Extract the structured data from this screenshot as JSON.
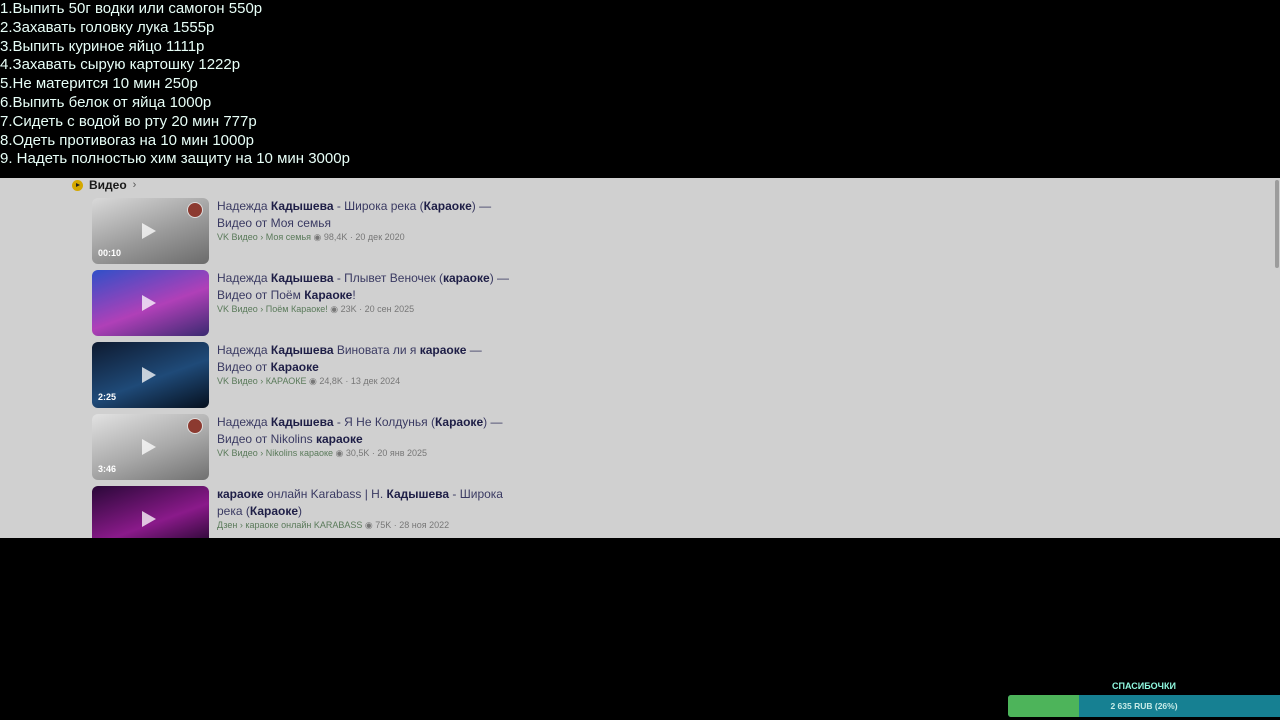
{
  "overlay": {
    "lines": [
      "1.Выпить 50г водки или самогон 550р",
      "2.Захавать головку лука 1555р",
      "3.Выпить куриное яйцо 1111р",
      "4.Захавать сырую картошку 1222р",
      "5.Не матерится 10 мин 250р",
      "6.Выпить белок от яйца 1000р",
      "7.Сидеть с водой во рту 20 мин 777р",
      "8.Одеть противогаз на 10 мин 1000р",
      "9. Надеть полностью хим защиту на 10 мин 3000р"
    ]
  },
  "video_section": {
    "title": "Видео",
    "chevron": "›",
    "items": [
      {
        "title_parts": [
          [
            "Надежда ",
            false
          ],
          [
            "Кадышева",
            true
          ],
          [
            " - Широка река (",
            false
          ],
          [
            "Караоке",
            true
          ],
          [
            ") — Видео от Моя семья",
            false
          ]
        ],
        "meta": {
          "source": "VK Видео › Моя семья",
          "views": "98,4K",
          "date": "20 дек 2020"
        },
        "duration": "00:10",
        "thumb_colors": [
          "#d9d9d9",
          "#9a9a9a",
          "#6b6b6b"
        ],
        "badge": true
      },
      {
        "title_parts": [
          [
            "Надежда ",
            false
          ],
          [
            "Кадышева",
            true
          ],
          [
            " - Плывет Веночек (",
            false
          ],
          [
            "караоке",
            true
          ],
          [
            ") — Видео от Поём ",
            false
          ],
          [
            "Караоке",
            true
          ],
          [
            "!",
            false
          ]
        ],
        "meta": {
          "source": "VK Видео › Поём Караоке!",
          "views": "23K",
          "date": "20 сен 2025"
        },
        "duration": "",
        "thumb_colors": [
          "#3050c8",
          "#b040b8",
          "#3a2a70"
        ],
        "badge": false
      },
      {
        "title_parts": [
          [
            "Надежда ",
            false
          ],
          [
            "Кадышева",
            true
          ],
          [
            " Виновата ли я ",
            false
          ],
          [
            "караоке",
            true
          ],
          [
            " — Видео от ",
            false
          ],
          [
            "Караоке",
            true
          ]
        ],
        "meta": {
          "source": "VK Видео › КАРАОКЕ",
          "views": "24,8K",
          "date": "13 дек 2024"
        },
        "duration": "2:25",
        "thumb_colors": [
          "#0e1a30",
          "#1f4a78",
          "#06101e"
        ],
        "badge": false
      },
      {
        "title_parts": [
          [
            "Надежда ",
            false
          ],
          [
            "Кадышева",
            true
          ],
          [
            " - Я Не Колдунья (",
            false
          ],
          [
            "Караоке",
            true
          ],
          [
            ") — Видео от Nikolins ",
            false
          ],
          [
            "караоке",
            true
          ]
        ],
        "meta": {
          "source": "VK Видео › Nikolins караоке",
          "views": "30,5K",
          "date": "20 янв 2025"
        },
        "duration": "3:46",
        "thumb_colors": [
          "#e2e2e2",
          "#a8a8a8",
          "#707070"
        ],
        "badge": true
      },
      {
        "title_parts": [
          [
            "караоке",
            true
          ],
          [
            " онлайн Karabass | Н. ",
            false
          ],
          [
            "Кадышева",
            true
          ],
          [
            " - Широка река (",
            false
          ],
          [
            "Караоке",
            true
          ],
          [
            ")",
            false
          ]
        ],
        "meta": {
          "source": "Дзен › караоке онлайн KARABASS",
          "views": "75K",
          "date": "28 ноя 2022"
        },
        "duration": "",
        "thumb_colors": [
          "#2a0838",
          "#8a1a8a",
          "#140420"
        ],
        "badge": false
      }
    ]
  },
  "donation": {
    "label": "СПАСИБОЧКИ",
    "progress_text": "2 635 RUB (26%)",
    "progress_fraction": 0.26,
    "fill_color": "#4db45a",
    "track_color": "#168092"
  }
}
